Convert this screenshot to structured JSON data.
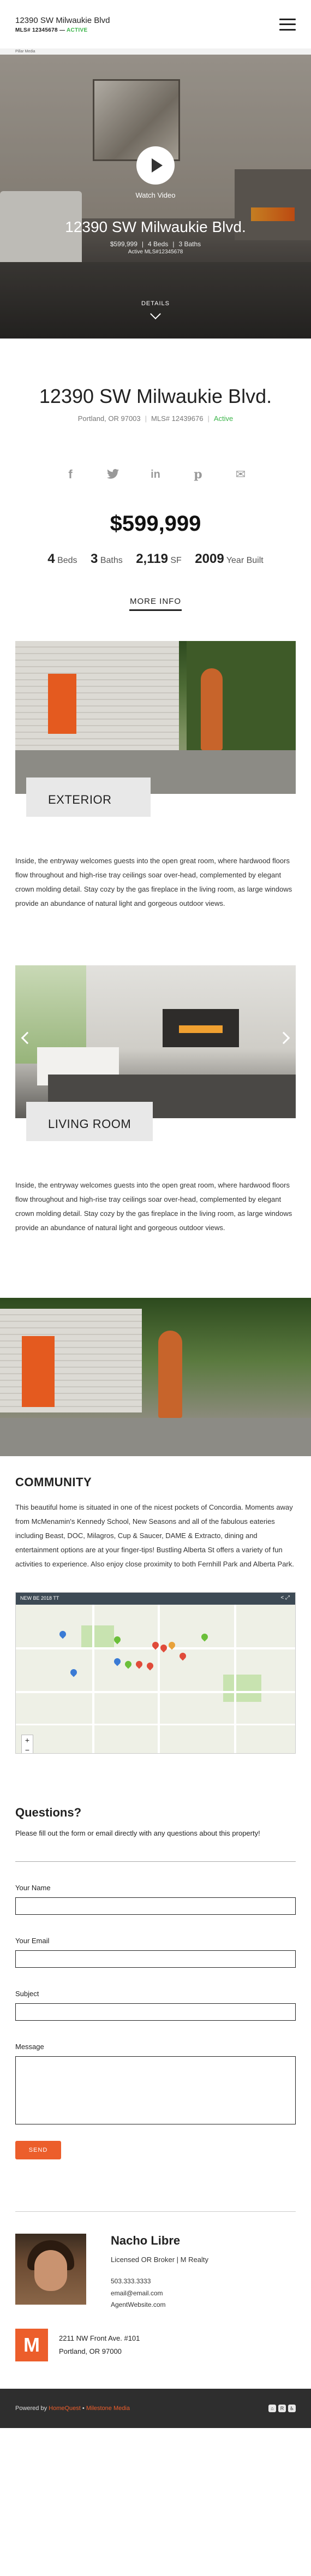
{
  "header": {
    "address": "12390 SW Milwaukie Blvd",
    "mls_label": "MLS# 12345678",
    "dash": "—",
    "status": "ACTIVE"
  },
  "sliver": {
    "text": "Pillar Media"
  },
  "hero": {
    "watch_label": "Watch Video",
    "title": "12390 SW Milwaukie Blvd.",
    "price": "$599,999",
    "beds": "4 Beds",
    "baths": "3 Baths",
    "sub": "Active MLS#12345678",
    "details_label": "DETAILS"
  },
  "property": {
    "title": "12390 SW Milwaukie Blvd.",
    "city": "Portland, OR 97003",
    "sep": "|",
    "mls": "MLS# 12439676",
    "status": "Active",
    "price": "$599,999",
    "beds_n": "4",
    "beds_l": "Beds",
    "baths_n": "3",
    "baths_l": "Baths",
    "sqft_n": "2,119",
    "sqft_l": "SF",
    "year_n": "2009",
    "year_l": "Year Built",
    "more_label": "MORE INFO"
  },
  "social": {
    "facebook": "f",
    "twitter": "t",
    "linkedin": "in",
    "pinterest": "p",
    "email": "✉"
  },
  "rooms": [
    {
      "label": "EXTERIOR",
      "desc": "Inside, the entryway welcomes guests into the open great room, where hardwood floors flow throughout and high-rise tray ceilings soar over-head, complemented by elegant crown molding detail. Stay cozy by the gas fireplace in the living room, as large windows provide an abundance of natural light and gorgeous outdoor views."
    },
    {
      "label": "LIVING ROOM",
      "desc": "Inside, the entryway welcomes guests into the open great room, where hardwood floors flow throughout and high-rise tray ceilings soar over-head, complemented by elegant crown molding detail. Stay cozy by the gas fireplace in the living room, as large windows provide an abundance of natural light and gorgeous outdoor views."
    }
  ],
  "community": {
    "title": "COMMUNITY",
    "text": "This beautiful home is situated in one of the nicest pockets of Concordia. Moments away from McMenamin's Kennedy School, New Seasons and all of the fabulous eateries including Beast, DOC, Milagros, Cup & Saucer, DAME & Extracto, dining and entertainment options are at your finger-tips! Bustling Alberta St offers a variety of fun activities to experience. Also enjoy close proximity to both Fernhill Park and Alberta Park.",
    "map_title": "NEW BE 2018 TT",
    "map_share": "< ⤢"
  },
  "contact": {
    "title": "Questions?",
    "intro": "Please fill out the form or email directly with any questions about this property!",
    "name_label": "Your Name",
    "email_label": "Your Email",
    "subject_label": "Subject",
    "message_label": "Message",
    "send_label": "SEND"
  },
  "agent": {
    "name": "Nacho Libre",
    "title": "Licensed OR Broker | M Realty",
    "phone": "503.333.3333",
    "email": "email@email.com",
    "website": "AgentWebsite.com",
    "office_line1": "2211 NW Front Ave. #101",
    "office_line2": "Portland, OR 97000",
    "logo_letter": "M"
  },
  "footer": {
    "powered": "Powered by",
    "brand1": "HomeQuest",
    "bullet": "•",
    "brand2": "Milestone Media",
    "icons": [
      "⌂",
      "R",
      "♿"
    ]
  },
  "colors": {
    "accent": "#ec5e2b",
    "active": "#3bb54a",
    "footer_bg": "#2e2e2e"
  }
}
